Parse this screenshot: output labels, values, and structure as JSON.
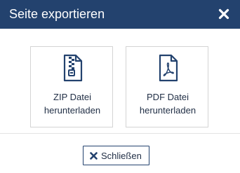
{
  "dialog": {
    "title": "Seite exportieren",
    "close_icon": "close-icon",
    "options": [
      {
        "icon": "zip-file-icon",
        "line1": "ZIP Datei",
        "line2": "herunterladen"
      },
      {
        "icon": "pdf-file-icon",
        "line1": "PDF Datei",
        "line2": "herunterladen"
      }
    ],
    "close_button": {
      "icon": "close-icon",
      "label": "Schließen"
    }
  },
  "colors": {
    "header_bg": "#23426e",
    "icon_color": "#23426e",
    "text_color": "#1f2d44",
    "border_color": "#d4d4d4"
  }
}
